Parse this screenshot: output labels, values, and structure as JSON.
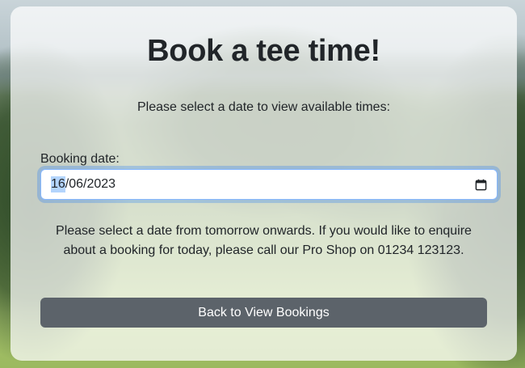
{
  "page": {
    "title": "Book a tee time!",
    "subtitle": "Please select a date to view available times:"
  },
  "booking_form": {
    "date_label": "Booking date:",
    "date_value_day": "16",
    "date_value_rest": "/06/2023",
    "date_value": "16/06/2023",
    "calendar_icon": "calendar-icon",
    "notice": "Please select a date from tomorrow onwards. If you would like to enquire about a booking for today, please call our Pro Shop on 01234 123123."
  },
  "actions": {
    "back_label": "Back to View Bookings"
  },
  "colors": {
    "button_bg": "#5c636a",
    "focus_border": "#86b7fe",
    "text": "#212529"
  }
}
